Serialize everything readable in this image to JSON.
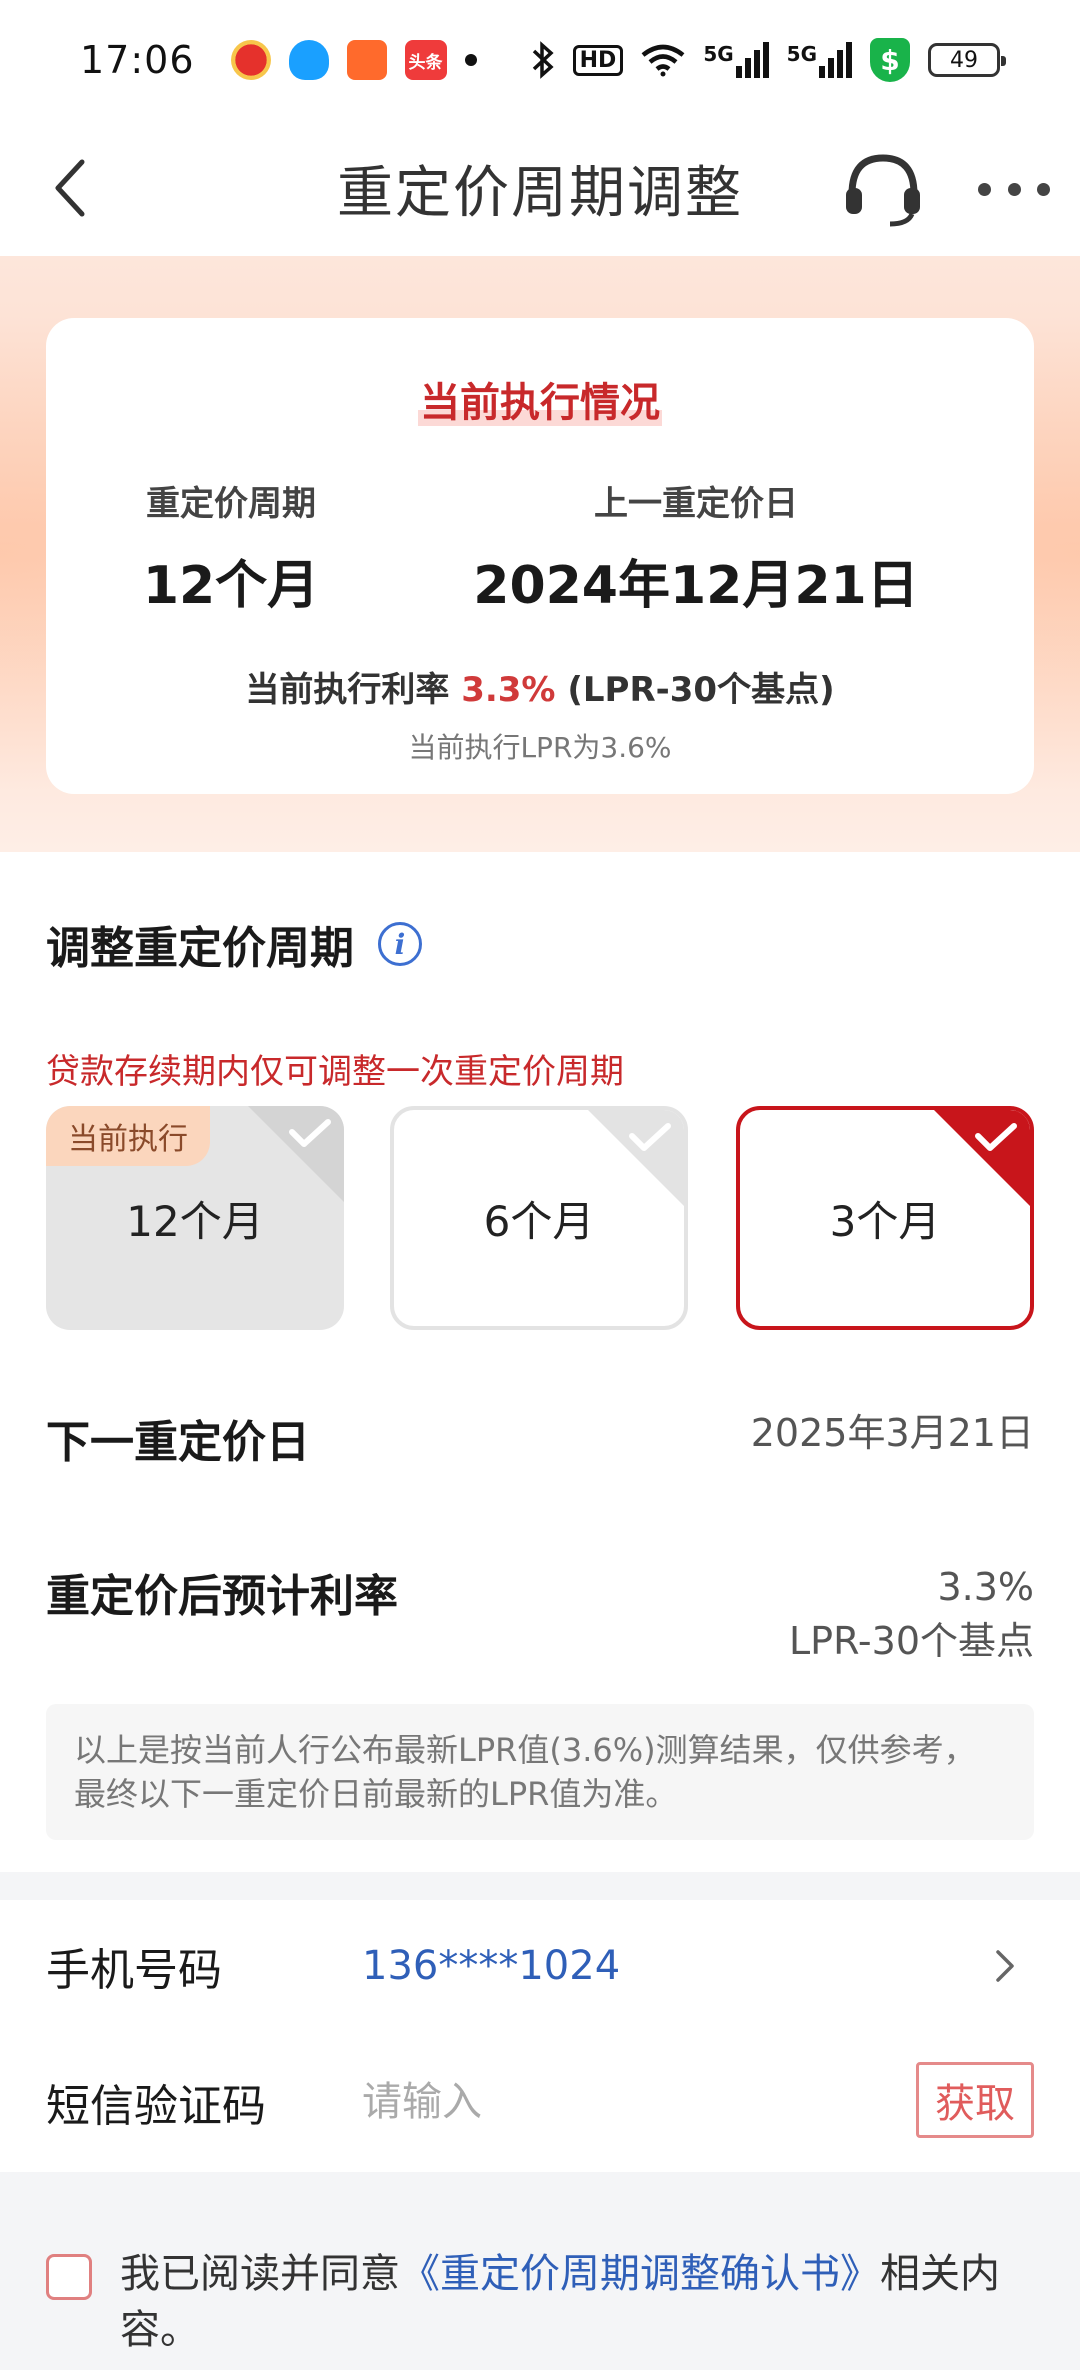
{
  "status_bar": {
    "time": "17:06",
    "notification_apps": [
      "notif-app-icon",
      "qq-icon",
      "app-icon",
      "toutiao-icon"
    ],
    "toutiao_label": "头条",
    "hd_label": "HD",
    "net_label_1": "5G",
    "net_label_2": "5G",
    "battery": "49"
  },
  "nav": {
    "title": "重定价周期调整"
  },
  "current": {
    "title": "当前执行情况",
    "cycle_label": "重定价周期",
    "cycle_value": "12个月",
    "last_date_label": "上一重定价日",
    "last_date_value": "2024年12月21日",
    "rate_prefix": "当前执行利率",
    "rate_value": "3.3%",
    "rate_suffix": "(LPR-30个基点)",
    "lpr_note": "当前执行LPR为3.6%"
  },
  "adjust": {
    "title": "调整重定价周期",
    "warning": "贷款存续期内仅可调整一次重定价周期",
    "current_badge": "当前执行",
    "options": [
      {
        "label": "12个月",
        "state": "current"
      },
      {
        "label": "6个月",
        "state": "unselected"
      },
      {
        "label": "3个月",
        "state": "selected"
      }
    ],
    "next_date_label": "下一重定价日",
    "next_date_value": "2025年3月21日",
    "after_rate_label": "重定价后预计利率",
    "after_rate_value": "3.3%",
    "after_rate_sub": "LPR-30个基点",
    "disclaimer": "以上是按当前人行公布最新LPR值(3.6%)测算结果，仅供参考，最终以下一重定价日前最新的LPR值为准。"
  },
  "form": {
    "phone_label": "手机号码",
    "phone_value": "136****1024",
    "sms_label": "短信验证码",
    "sms_placeholder": "请输入",
    "get_code": "获取"
  },
  "agreement": {
    "prefix": "我已阅读并同意",
    "link": "《重定价周期调整确认书》",
    "suffix": "相关内容。"
  },
  "colors": {
    "accent_red": "#c8151b",
    "link_blue": "#2f5fb8",
    "badge_bg": "#fbd6bd"
  }
}
